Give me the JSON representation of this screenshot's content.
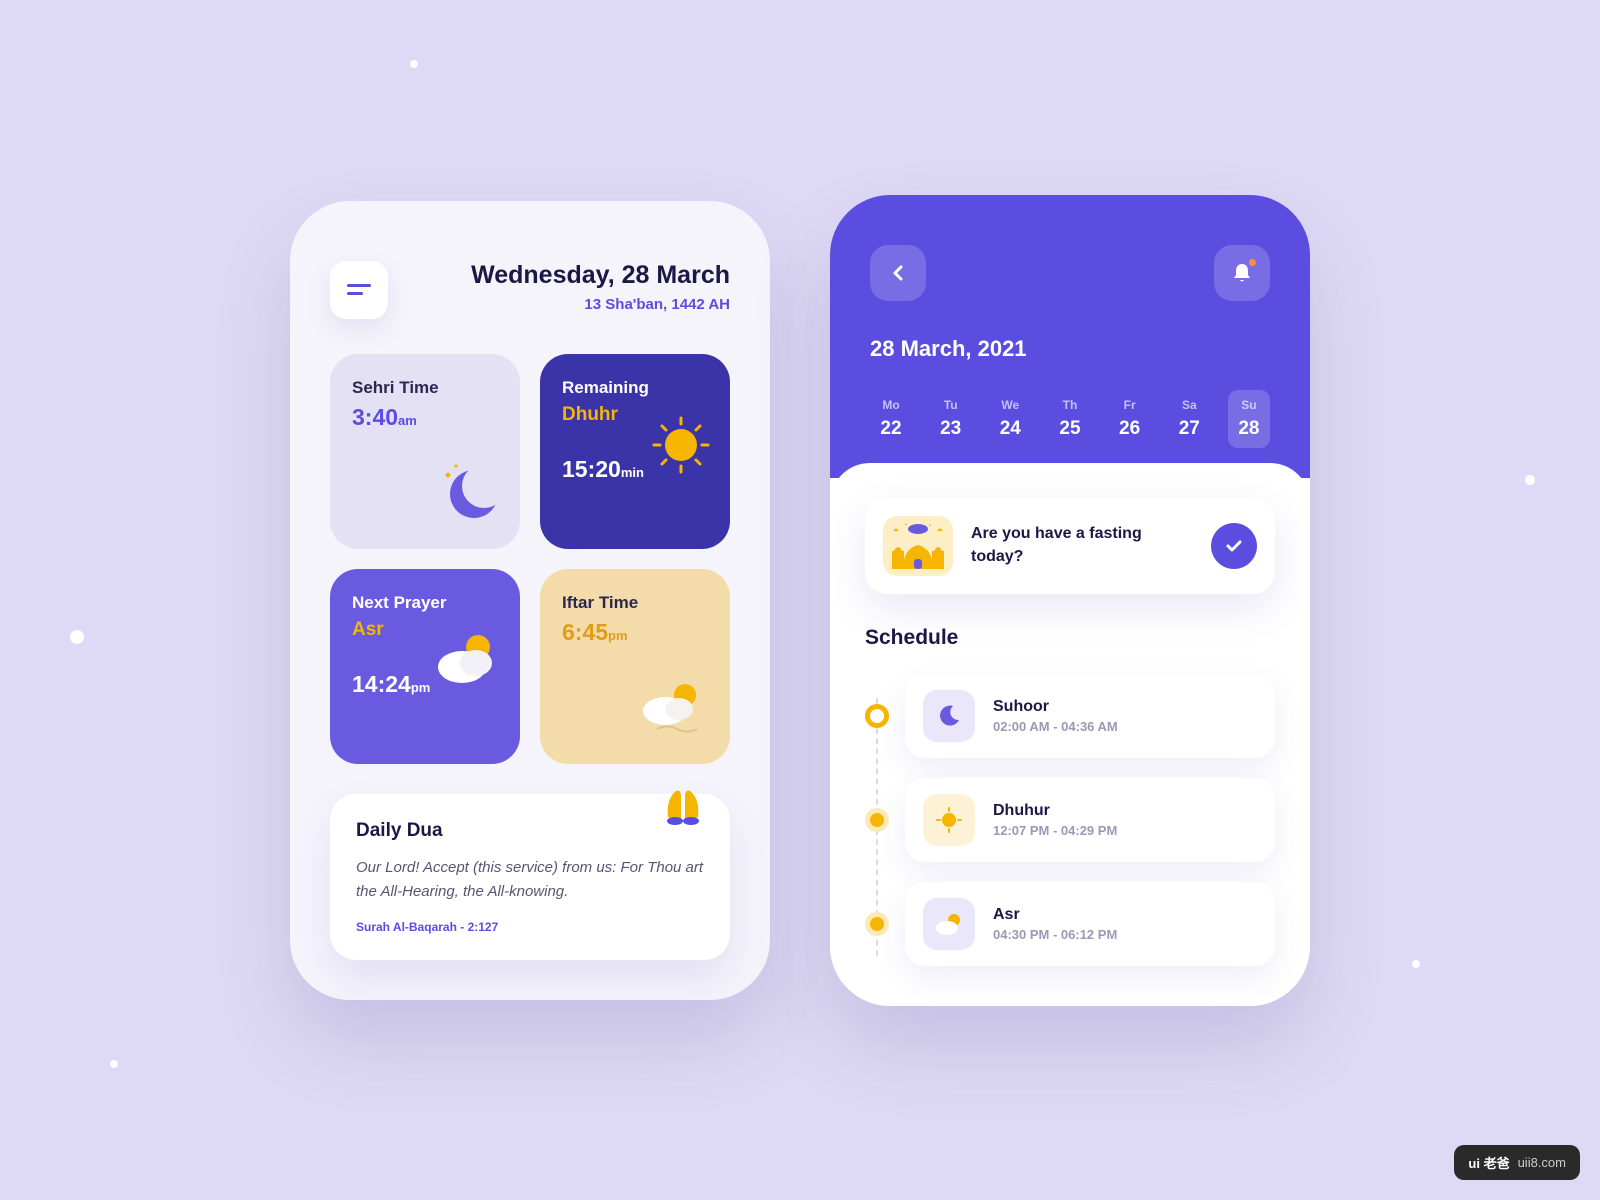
{
  "left": {
    "date_main": "Wednesday, 28 March",
    "date_sub": "13 Sha'ban, 1442 AH",
    "cards": {
      "sehri": {
        "label": "Sehri Time",
        "value": "3:40",
        "unit": "am"
      },
      "remaining": {
        "label": "Remaining",
        "sub": "Dhuhr",
        "value": "15:20",
        "unit": "min"
      },
      "next": {
        "label": "Next Prayer",
        "sub": "Asr",
        "value": "14:24",
        "unit": "pm"
      },
      "iftar": {
        "label": "Iftar Time",
        "value": "6:45",
        "unit": "pm"
      }
    },
    "dua": {
      "title": "Daily Dua",
      "text": "Our Lord! Accept (this service) from us: For Thou art the All-Hearing, the All-knowing.",
      "ref": "Surah Al-Baqarah - 2:127"
    }
  },
  "right": {
    "date_label": "28 March, 2021",
    "week": [
      {
        "dow": "Mo",
        "num": "22"
      },
      {
        "dow": "Tu",
        "num": "23"
      },
      {
        "dow": "We",
        "num": "24"
      },
      {
        "dow": "Th",
        "num": "25"
      },
      {
        "dow": "Fr",
        "num": "26"
      },
      {
        "dow": "Sa",
        "num": "27"
      },
      {
        "dow": "Su",
        "num": "28"
      }
    ],
    "fasting_question": "Are you have a fasting today?",
    "schedule_title": "Schedule",
    "schedule": [
      {
        "name": "Suhoor",
        "time": "02:00 AM - 04:36 AM"
      },
      {
        "name": "Dhuhur",
        "time": "12:07 PM - 04:29 PM"
      },
      {
        "name": "Asr",
        "time": "04:30 PM - 06:12 PM"
      }
    ]
  },
  "watermark": {
    "brand": "ui 老爸",
    "url": "uii8.com"
  }
}
